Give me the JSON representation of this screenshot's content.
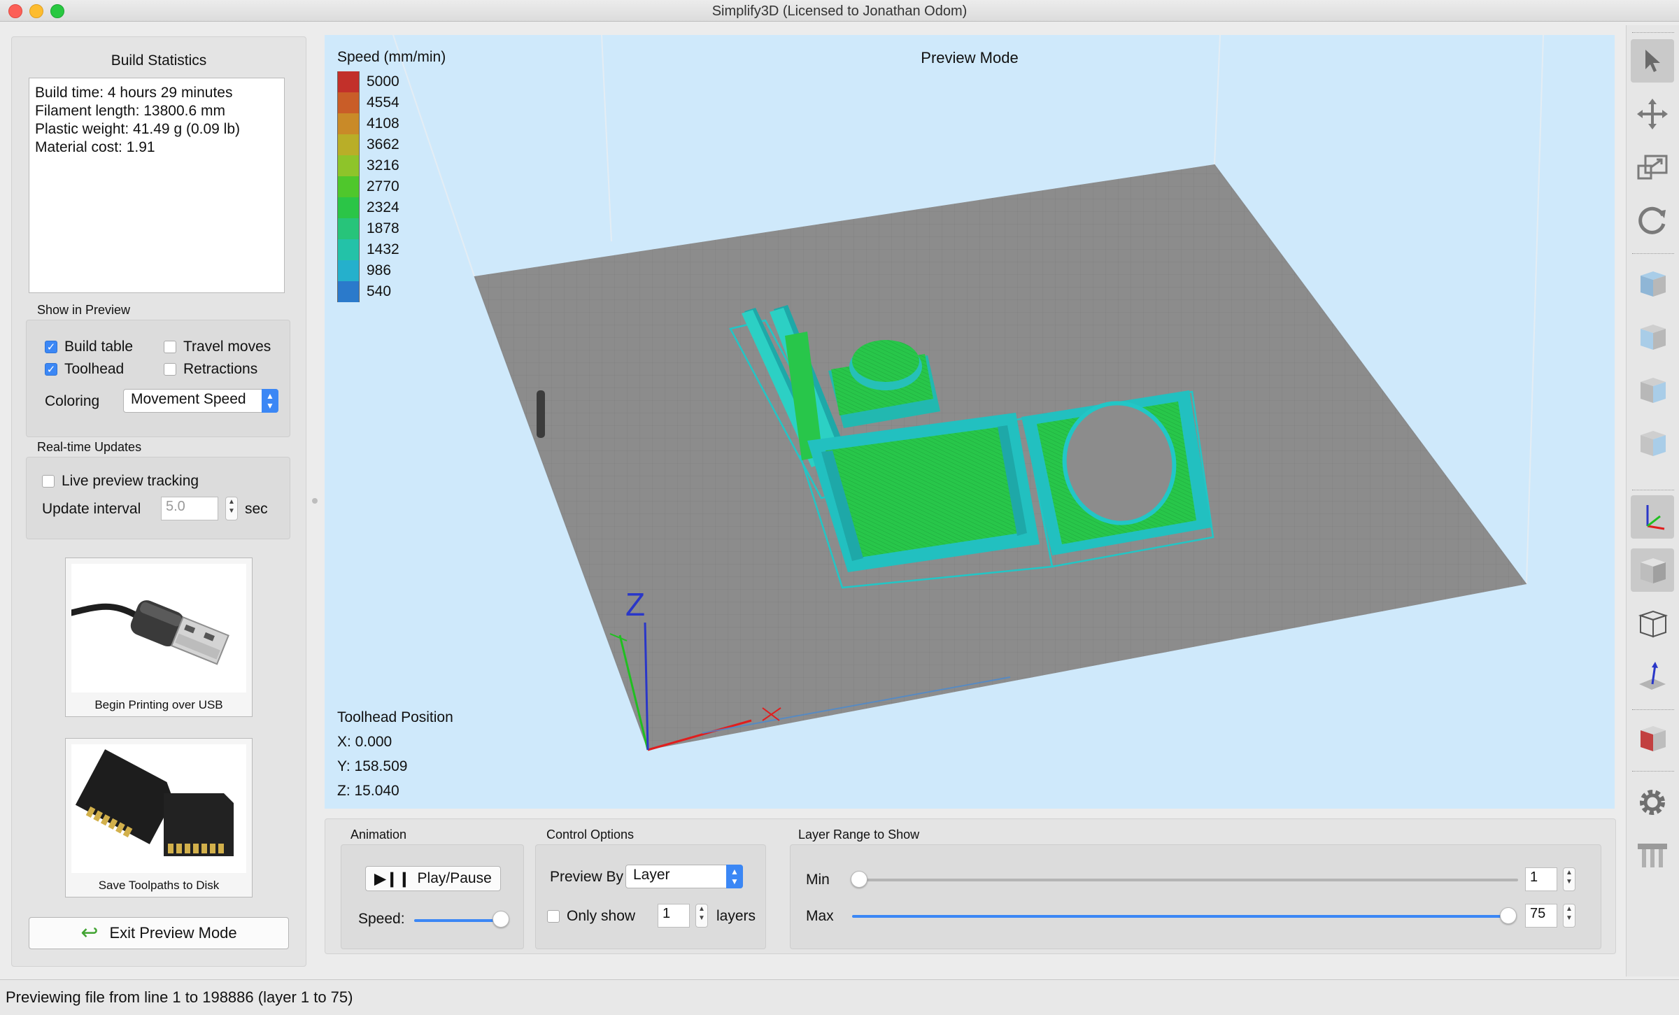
{
  "window": {
    "title": "Simplify3D (Licensed to Jonathan Odom)"
  },
  "left_panel": {
    "build_statistics": {
      "title": "Build Statistics",
      "lines": [
        "Build time: 4 hours 29 minutes",
        "Filament length: 13800.6 mm",
        "Plastic weight: 41.49 g (0.09 lb)",
        "Material cost: 1.91"
      ]
    },
    "show_in_preview": {
      "label": "Show in Preview",
      "build_table": {
        "label": "Build table",
        "checked": true
      },
      "travel_moves": {
        "label": "Travel moves",
        "checked": false
      },
      "toolhead": {
        "label": "Toolhead",
        "checked": true
      },
      "retractions": {
        "label": "Retractions",
        "checked": false
      },
      "coloring_label": "Coloring",
      "coloring_value": "Movement Speed"
    },
    "realtime_updates": {
      "label": "Real-time Updates",
      "live_preview": {
        "label": "Live preview tracking",
        "checked": false
      },
      "update_interval_label": "Update interval",
      "update_interval_value": "5.0",
      "unit": "sec"
    },
    "usb_button": {
      "caption": "Begin Printing over USB"
    },
    "disk_button": {
      "caption": "Save Toolpaths to Disk"
    },
    "exit_button": {
      "label": "Exit Preview Mode"
    }
  },
  "viewport": {
    "mode_title": "Preview Mode",
    "legend": {
      "title": "Speed (mm/min)",
      "entries": [
        {
          "value": "5000",
          "color": "#c2302a"
        },
        {
          "value": "4554",
          "color": "#c95d28"
        },
        {
          "value": "4108",
          "color": "#c98a28"
        },
        {
          "value": "3662",
          "color": "#b9ae28"
        },
        {
          "value": "3216",
          "color": "#8ec42a"
        },
        {
          "value": "2770",
          "color": "#4fc72c"
        },
        {
          "value": "2324",
          "color": "#2bc547"
        },
        {
          "value": "1878",
          "color": "#27c47a"
        },
        {
          "value": "1432",
          "color": "#23c2a8"
        },
        {
          "value": "986",
          "color": "#25b0cc"
        },
        {
          "value": "540",
          "color": "#2b7acb"
        }
      ]
    },
    "toolhead_position": {
      "title": "Toolhead Position",
      "x": "X: 0.000",
      "y": "Y: 158.509",
      "z": "Z: 15.040"
    },
    "axis_label_z": "Z"
  },
  "bottom_panel": {
    "animation": {
      "label": "Animation",
      "play_pause": "Play/Pause",
      "speed_label": "Speed:",
      "speed_fraction": 1.0
    },
    "control_options": {
      "label": "Control Options",
      "preview_by_label": "Preview By",
      "preview_by_value": "Layer",
      "only_show_label": "Only show",
      "only_show_checked": false,
      "only_show_value": "1",
      "layers_label": "layers"
    },
    "layer_range": {
      "label": "Layer Range to Show",
      "min_label": "Min",
      "min_value": "1",
      "max_label": "Max",
      "max_value": "75"
    }
  },
  "status_bar": {
    "text": "Previewing file from line 1 to 198886 (layer 1 to 75)"
  },
  "right_toolbar": {
    "tools": [
      "select-arrow-icon",
      "move-icon",
      "scale-icon",
      "rotate-icon",
      "view-top-icon",
      "view-front-icon",
      "view-left-icon",
      "view-right-icon",
      "axes-icon",
      "solid-view-icon",
      "wireframe-view-icon",
      "normals-icon",
      "cross-section-icon",
      "settings-gear-icon",
      "supports-icon"
    ]
  },
  "colors": {
    "accent": "#3b87f5",
    "toolpath_green": "#22cc44",
    "toolpath_cyan": "#22c6c6",
    "bed_gray": "#8a8a8a",
    "viewport_bg": "#cfe9fb"
  }
}
